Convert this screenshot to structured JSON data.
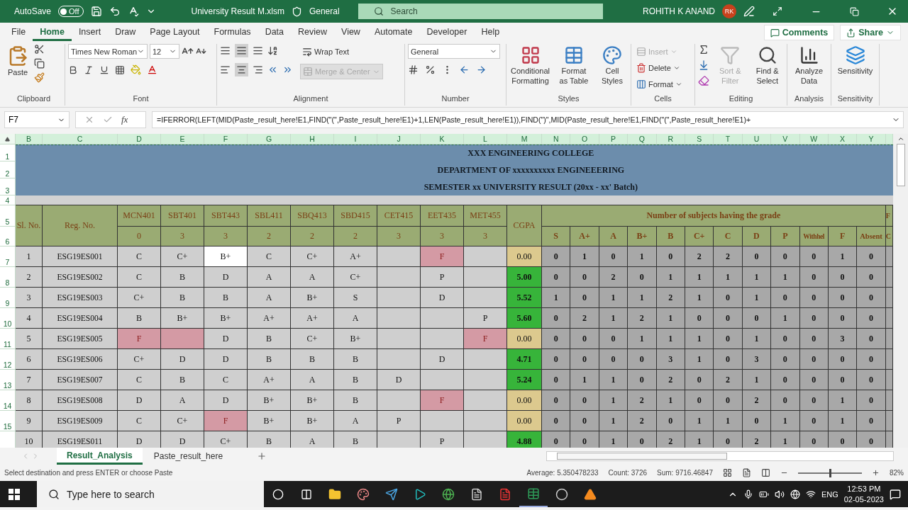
{
  "title_bar": {
    "autosave": {
      "label": "AutoSave",
      "on": false,
      "state_text": "Off"
    },
    "file_name": "University Result M.xlsm",
    "sensitivity_label": "General",
    "search": {
      "placeholder": "Search"
    },
    "user_name": "ROHITH K ANAND",
    "avatar_initials": "RK"
  },
  "menu_tabs": [
    {
      "label": "File",
      "selected": false
    },
    {
      "label": "Home",
      "selected": true
    },
    {
      "label": "Insert",
      "selected": false
    },
    {
      "label": "Draw",
      "selected": false
    },
    {
      "label": "Page Layout",
      "selected": false
    },
    {
      "label": "Formulas",
      "selected": false
    },
    {
      "label": "Data",
      "selected": false
    },
    {
      "label": "Review",
      "selected": false
    },
    {
      "label": "View",
      "selected": false
    },
    {
      "label": "Automate",
      "selected": false
    },
    {
      "label": "Developer",
      "selected": false
    },
    {
      "label": "Help",
      "selected": false
    }
  ],
  "comments_button": "Comments",
  "share_button": "Share",
  "ribbon": {
    "clipboard": {
      "paste": "Paste",
      "label": "Clipboard"
    },
    "font": {
      "font_name": "Times New Roman",
      "font_size": "12",
      "label": "Font"
    },
    "alignment": {
      "wrap_text": {
        "label": "Wrap Text",
        "disabled": false
      },
      "merge_center": {
        "label": "Merge & Center",
        "disabled": true
      },
      "label": "Alignment"
    },
    "number": {
      "format": "General",
      "label": "Number"
    },
    "styles": {
      "buttons": [
        {
          "label": "Conditional Formatting",
          "kind": "conditional"
        },
        {
          "label": "Format as Table",
          "kind": "table"
        },
        {
          "label": "Cell Styles",
          "kind": "cellstyle"
        }
      ],
      "label": "Styles"
    },
    "cells": {
      "buttons": [
        {
          "label": "Insert",
          "disabled": true
        },
        {
          "label": "Delete",
          "disabled": false
        },
        {
          "label": "Format",
          "disabled": false
        }
      ],
      "label": "Cells"
    },
    "editing": {
      "buttons": [
        {
          "label": "Sort & Filter",
          "disabled": true,
          "kind": "sort"
        },
        {
          "label": "Find & Select",
          "disabled": false,
          "kind": "find"
        }
      ],
      "label": "Editing"
    },
    "analysis": {
      "button": "Analyze Data",
      "label": "Analysis"
    },
    "sensitivity": {
      "button": "Sensitivity",
      "label": "Sensitivity"
    }
  },
  "formula_bar": {
    "name_box": "F7",
    "function_symbol": "fx",
    "formula": "=IFERROR(LEFT(MID(Paste_result_here!E1,FIND(\"(\",Paste_result_here!E1)+1,LEN(Paste_result_here!E1)),FIND(\")\",MID(Paste_result_here!E1,FIND(\"(\",Paste_result_here!E1)+"
  },
  "sheet": {
    "column_letters": [
      "B",
      "C",
      "D",
      "E",
      "F",
      "G",
      "H",
      "I",
      "J",
      "K",
      "L",
      "M",
      "N",
      "O",
      "P",
      "Q",
      "R",
      "S",
      "T",
      "U",
      "V",
      "W",
      "X",
      "Y"
    ],
    "row_numbers": [
      "1",
      "2",
      "3",
      "4",
      "5",
      "6",
      "7",
      "8",
      "9",
      "10",
      "11",
      "12",
      "13",
      "14",
      "15"
    ],
    "title_lines": [
      "XXX ENGINEERING COLLEGE",
      "DEPARTMENT OF xxxxxxxxxx ENGINEEERING",
      "SEMESTER xx UNIVERSITY RESULT (20xx - xx' Batch)"
    ],
    "headers": {
      "serial": "Sl. No.",
      "reg_no": "Reg. No.",
      "subjects": [
        {
          "code": "MCN401",
          "credits": "0"
        },
        {
          "code": "SBT401",
          "credits": "3"
        },
        {
          "code": "SBT443",
          "credits": "3"
        },
        {
          "code": "SBL411",
          "credits": "2"
        },
        {
          "code": "SBQ413",
          "credits": "2"
        },
        {
          "code": "SBD415",
          "credits": "2"
        },
        {
          "code": "CET415",
          "credits": "3"
        },
        {
          "code": "EET435",
          "credits": "3"
        },
        {
          "code": "MET455",
          "credits": "3"
        }
      ],
      "cgpa": "CGPA",
      "grade_group": "Number of subjects having the grade",
      "grades": [
        "S",
        "A+",
        "A",
        "B+",
        "B",
        "C+",
        "C",
        "D",
        "P",
        "Withhel",
        "F",
        "Absent"
      ],
      "cut_column": [
        "F",
        "C"
      ]
    },
    "rows": [
      {
        "serial": "1",
        "reg_no": "ESG19ES001",
        "grades": [
          {
            "text": "C",
            "failed": false,
            "active": false
          },
          {
            "text": "C+",
            "failed": false,
            "active": false
          },
          {
            "text": "B+",
            "failed": false,
            "active": true
          },
          {
            "text": "C",
            "failed": false,
            "active": false
          },
          {
            "text": "C+",
            "failed": false,
            "active": false
          },
          {
            "text": "A+",
            "failed": false,
            "active": false
          },
          {
            "failed": false,
            "active": false
          },
          {
            "text": "F",
            "failed": true,
            "active": false
          },
          {
            "failed": false,
            "active": false
          }
        ],
        "cgpa": {
          "text": "0.00",
          "passed": false
        },
        "counts": [
          "0",
          "1",
          "0",
          "1",
          "0",
          "2",
          "2",
          "0",
          "0",
          "0",
          "1",
          "0"
        ]
      },
      {
        "serial": "2",
        "reg_no": "ESG19ES002",
        "grades": [
          {
            "text": "C",
            "failed": false,
            "active": false
          },
          {
            "text": "B",
            "failed": false,
            "active": false
          },
          {
            "text": "D",
            "failed": false,
            "active": false
          },
          {
            "text": "A",
            "failed": false,
            "active": false
          },
          {
            "text": "A",
            "failed": false,
            "active": false
          },
          {
            "text": "C+",
            "failed": false,
            "active": false
          },
          {
            "failed": false,
            "active": false
          },
          {
            "text": "P",
            "failed": false,
            "active": false
          },
          {
            "failed": false,
            "active": false
          }
        ],
        "cgpa": {
          "text": "5.00",
          "passed": true
        },
        "counts": [
          "0",
          "0",
          "2",
          "0",
          "1",
          "1",
          "1",
          "1",
          "1",
          "0",
          "0",
          "0"
        ]
      },
      {
        "serial": "3",
        "reg_no": "ESG19ES003",
        "grades": [
          {
            "text": "C+",
            "failed": false,
            "active": false
          },
          {
            "text": "B",
            "failed": false,
            "active": false
          },
          {
            "text": "B",
            "failed": false,
            "active": false
          },
          {
            "text": "A",
            "failed": false,
            "active": false
          },
          {
            "text": "B+",
            "failed": false,
            "active": false
          },
          {
            "text": "S",
            "failed": false,
            "active": false
          },
          {
            "failed": false,
            "active": false
          },
          {
            "text": "D",
            "failed": false,
            "active": false
          },
          {
            "failed": false,
            "active": false
          }
        ],
        "cgpa": {
          "text": "5.52",
          "passed": true
        },
        "counts": [
          "1",
          "0",
          "1",
          "1",
          "2",
          "1",
          "0",
          "1",
          "0",
          "0",
          "0",
          "0"
        ]
      },
      {
        "serial": "4",
        "reg_no": "ESG19ES004",
        "grades": [
          {
            "text": "B",
            "failed": false,
            "active": false
          },
          {
            "text": "B+",
            "failed": false,
            "active": false
          },
          {
            "text": "B+",
            "failed": false,
            "active": false
          },
          {
            "text": "A+",
            "failed": false,
            "active": false
          },
          {
            "text": "A+",
            "failed": false,
            "active": false
          },
          {
            "text": "A",
            "failed": false,
            "active": false
          },
          {
            "failed": false,
            "active": false
          },
          {
            "failed": false,
            "active": false
          },
          {
            "text": "P",
            "failed": false,
            "active": false
          }
        ],
        "cgpa": {
          "text": "5.60",
          "passed": true
        },
        "counts": [
          "0",
          "2",
          "1",
          "2",
          "1",
          "0",
          "0",
          "0",
          "1",
          "0",
          "0",
          "0"
        ]
      },
      {
        "serial": "5",
        "reg_no": "ESG19ES005",
        "grades": [
          {
            "text": "F",
            "failed": true,
            "active": false
          },
          {
            "failed": true,
            "active": false
          },
          {
            "text": "D",
            "failed": false,
            "active": false
          },
          {
            "text": "B",
            "failed": false,
            "active": false
          },
          {
            "text": "C+",
            "failed": false,
            "active": false
          },
          {
            "text": "B+",
            "failed": false,
            "active": false
          },
          {
            "failed": false,
            "active": false
          },
          {
            "failed": false,
            "active": false
          },
          {
            "text": "F",
            "failed": true,
            "active": false
          }
        ],
        "cgpa": {
          "text": "0.00",
          "passed": false
        },
        "counts": [
          "0",
          "0",
          "0",
          "1",
          "1",
          "1",
          "0",
          "1",
          "0",
          "0",
          "3",
          "0"
        ]
      },
      {
        "serial": "6",
        "reg_no": "ESG19ES006",
        "grades": [
          {
            "text": "C+",
            "failed": false,
            "active": false
          },
          {
            "text": "D",
            "failed": false,
            "active": false
          },
          {
            "text": "D",
            "failed": false,
            "active": false
          },
          {
            "text": "B",
            "failed": false,
            "active": false
          },
          {
            "text": "B",
            "failed": false,
            "active": false
          },
          {
            "text": "B",
            "failed": false,
            "active": false
          },
          {
            "failed": false,
            "active": false
          },
          {
            "text": "D",
            "failed": false,
            "active": false
          },
          {
            "failed": false,
            "active": false
          }
        ],
        "cgpa": {
          "text": "4.71",
          "passed": true
        },
        "counts": [
          "0",
          "0",
          "0",
          "0",
          "3",
          "1",
          "0",
          "3",
          "0",
          "0",
          "0",
          "0"
        ]
      },
      {
        "serial": "7",
        "reg_no": "ESG19ES007",
        "grades": [
          {
            "text": "C",
            "failed": false,
            "active": false
          },
          {
            "text": "B",
            "failed": false,
            "active": false
          },
          {
            "text": "C",
            "failed": false,
            "active": false
          },
          {
            "text": "A+",
            "failed": false,
            "active": false
          },
          {
            "text": "A",
            "failed": false,
            "active": false
          },
          {
            "text": "B",
            "failed": false,
            "active": false
          },
          {
            "text": "D",
            "failed": false,
            "active": false
          },
          {
            "failed": false,
            "active": false
          },
          {
            "failed": false,
            "active": false
          }
        ],
        "cgpa": {
          "text": "5.24",
          "passed": true
        },
        "counts": [
          "0",
          "1",
          "1",
          "0",
          "2",
          "0",
          "2",
          "1",
          "0",
          "0",
          "0",
          "0"
        ]
      },
      {
        "serial": "8",
        "reg_no": "ESG19ES008",
        "grades": [
          {
            "text": "D",
            "failed": false,
            "active": false
          },
          {
            "text": "A",
            "failed": false,
            "active": false
          },
          {
            "text": "D",
            "failed": false,
            "active": false
          },
          {
            "text": "B+",
            "failed": false,
            "active": false
          },
          {
            "text": "B+",
            "failed": false,
            "active": false
          },
          {
            "text": "B",
            "failed": false,
            "active": false
          },
          {
            "failed": false,
            "active": false
          },
          {
            "text": "F",
            "failed": true,
            "active": false
          },
          {
            "failed": false,
            "active": false
          }
        ],
        "cgpa": {
          "text": "0.00",
          "passed": false
        },
        "counts": [
          "0",
          "0",
          "1",
          "2",
          "1",
          "0",
          "0",
          "2",
          "0",
          "0",
          "1",
          "0"
        ]
      },
      {
        "serial": "9",
        "reg_no": "ESG19ES009",
        "grades": [
          {
            "text": "C",
            "failed": false,
            "active": false
          },
          {
            "text": "C+",
            "failed": false,
            "active": false
          },
          {
            "text": "F",
            "failed": true,
            "active": false
          },
          {
            "text": "B+",
            "failed": false,
            "active": false
          },
          {
            "text": "B+",
            "failed": false,
            "active": false
          },
          {
            "text": "A",
            "failed": false,
            "active": false
          },
          {
            "text": "P",
            "failed": false,
            "active": false
          },
          {
            "failed": false,
            "active": false
          },
          {
            "failed": false,
            "active": false
          }
        ],
        "cgpa": {
          "text": "0.00",
          "passed": false
        },
        "counts": [
          "0",
          "0",
          "1",
          "2",
          "0",
          "1",
          "1",
          "0",
          "1",
          "0",
          "1",
          "0"
        ]
      },
      {
        "serial": "10",
        "reg_no": "ESG19ES011",
        "grades": [
          {
            "text": "D",
            "failed": false,
            "active": false
          },
          {
            "text": "D",
            "failed": false,
            "active": false
          },
          {
            "text": "C+",
            "failed": false,
            "active": false
          },
          {
            "text": "B",
            "failed": false,
            "active": false
          },
          {
            "text": "A",
            "failed": false,
            "active": false
          },
          {
            "text": "B",
            "failed": false,
            "active": false
          },
          {
            "failed": false,
            "active": false
          },
          {
            "text": "P",
            "failed": false,
            "active": false
          },
          {
            "failed": false,
            "active": false
          }
        ],
        "cgpa": {
          "text": "4.88",
          "passed": true
        },
        "counts": [
          "0",
          "0",
          "1",
          "0",
          "2",
          "1",
          "0",
          "2",
          "1",
          "0",
          "0",
          "0"
        ]
      }
    ]
  },
  "sheet_tabs": [
    {
      "label": "Result_Analysis",
      "selected": true
    },
    {
      "label": "Paste_result_here",
      "selected": false
    }
  ],
  "status_bar": {
    "message": "Select destination and press ENTER or choose Paste",
    "average": "Average: 5.350478233",
    "count": "Count: 3726",
    "sum": "Sum: 9716.46847",
    "zoom": {
      "level": 0.5,
      "reading": "82%"
    }
  },
  "taskbar": {
    "search_placeholder": "Type here to search",
    "language": "ENG",
    "time": "12:53 PM",
    "date": "02-05-2023"
  }
}
